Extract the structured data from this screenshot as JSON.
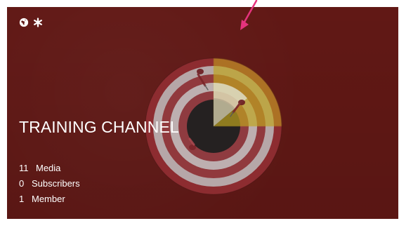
{
  "channel": {
    "title": "TRAINING CHANNEL",
    "stats": [
      {
        "count": "11",
        "label": "Media"
      },
      {
        "count": "0",
        "label": "Subscribers"
      },
      {
        "count": "1",
        "label": "Member"
      }
    ]
  },
  "icons": {
    "left": "globe-icon",
    "right": "asterisk-icon"
  },
  "colors": {
    "card_background": "#611815",
    "text": "#ffffff",
    "annotation_arrow": "#e5337d",
    "target_red": "#8b2f34",
    "target_white": "#bfbfbf",
    "target_center": "#1f1f1f",
    "target_accent": "#b39a1d"
  }
}
